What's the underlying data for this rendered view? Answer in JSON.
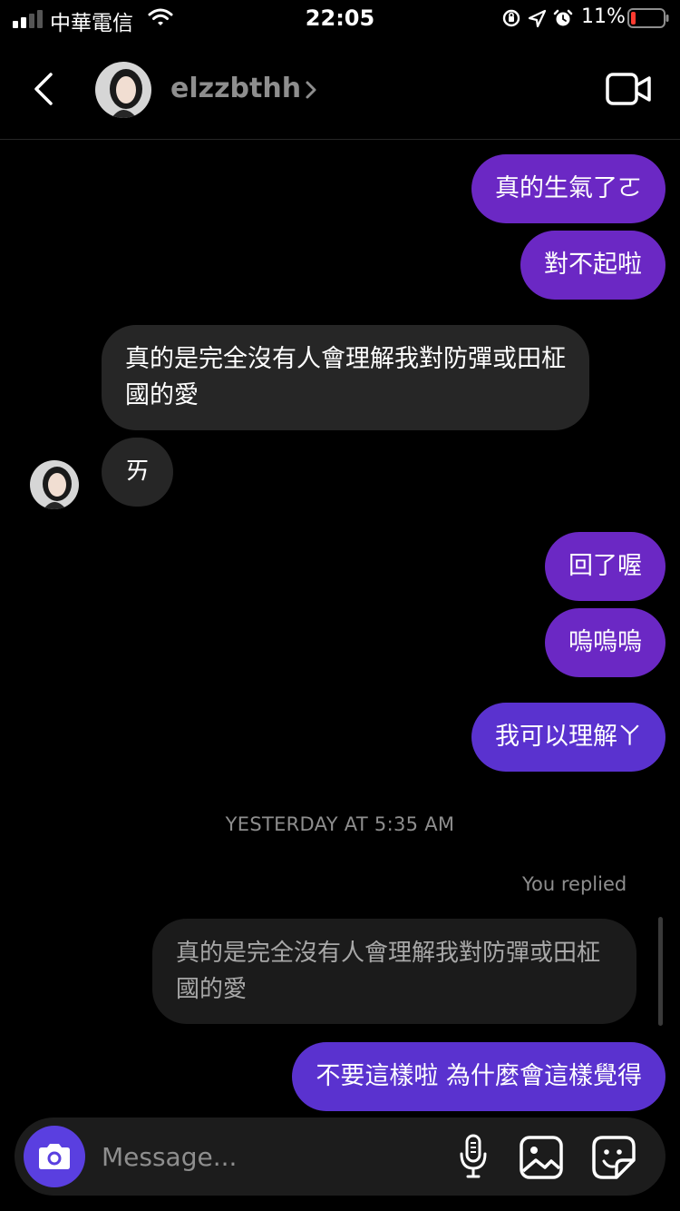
{
  "status": {
    "carrier": "中華電信",
    "time": "22:05",
    "battery": "11%"
  },
  "header": {
    "username": "elzzbthh"
  },
  "messages": [
    {
      "side": "mine",
      "text": "真的生氣了ㄛ"
    },
    {
      "side": "mine",
      "text": "對不起啦"
    },
    {
      "side": "theirs",
      "text": "真的是完全沒有人會理解我對防彈或田柾國的愛"
    },
    {
      "side": "theirs",
      "text": "ㄞ"
    },
    {
      "side": "mine",
      "text": "回了喔"
    },
    {
      "side": "mine",
      "text": "嗚嗚嗚"
    },
    {
      "side": "mine",
      "text": "我可以理解ㄚ"
    }
  ],
  "timestamp": "YESTERDAY AT 5:35 AM",
  "reply": {
    "label": "You replied",
    "quoted": "真的是完全沒有人會理解我對防彈或田柾國的愛",
    "text": "不要這樣啦 為什麼會這樣覺得"
  },
  "composer": {
    "placeholder": "Message..."
  },
  "colors": {
    "bubble_purple": "#6b28c4",
    "bubble_indigo": "#5a32cf",
    "bubble_gray": "#262626",
    "camera_button": "#5a3fe0",
    "battery_low": "#ff3b30"
  },
  "icons": [
    "signal-icon",
    "wifi-icon",
    "orientation-lock-icon",
    "location-icon",
    "alarm-icon",
    "battery-icon",
    "back-icon",
    "chevron-right-icon",
    "video-call-icon",
    "camera-icon",
    "microphone-icon",
    "photo-icon",
    "sticker-icon"
  ]
}
